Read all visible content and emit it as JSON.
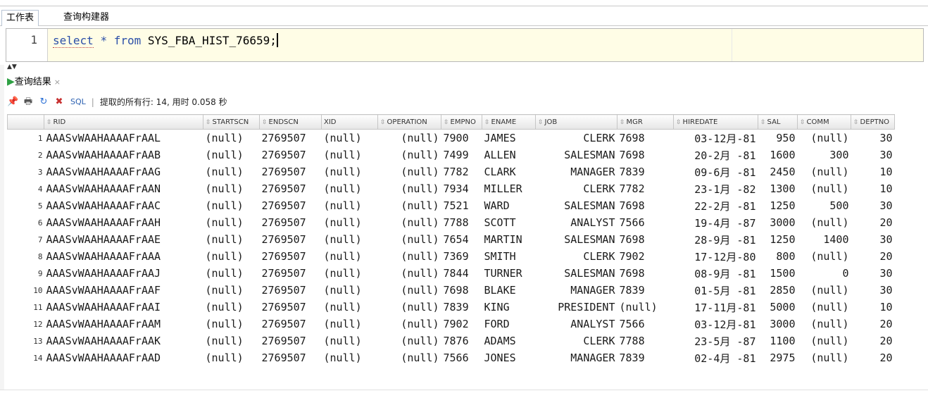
{
  "tabs": [
    "工作表",
    "查询构建器"
  ],
  "editor": {
    "line_number": "1",
    "kw_select": "select",
    "star": "*",
    "kw_from": "from",
    "table": "SYS_FBA_HIST_76659;"
  },
  "results": {
    "tab_label": "查询结果",
    "close": "×",
    "toolbar": {
      "sql_label": "SQL",
      "separator": "|",
      "status": "提取的所有行: 14, 用时 0.058 秒"
    },
    "columns": [
      "RID",
      "STARTSCN",
      "ENDSCN",
      "XID",
      "OPERATION",
      "EMPNO",
      "ENAME",
      "JOB",
      "MGR",
      "HIREDATE",
      "SAL",
      "COMM",
      "DEPTNO"
    ],
    "rows": [
      [
        "1",
        "AAASvWAAHAAAAFrAAL",
        "(null)",
        "2769507",
        "(null)",
        "(null)",
        "7900",
        "JAMES",
        "CLERK",
        "7698",
        "03-12月-81",
        "950",
        "(null)",
        "30"
      ],
      [
        "2",
        "AAASvWAAHAAAAFrAAB",
        "(null)",
        "2769507",
        "(null)",
        "(null)",
        "7499",
        "ALLEN",
        "SALESMAN",
        "7698",
        "20-2月 -81",
        "1600",
        "300",
        "30"
      ],
      [
        "3",
        "AAASvWAAHAAAAFrAAG",
        "(null)",
        "2769507",
        "(null)",
        "(null)",
        "7782",
        "CLARK",
        "MANAGER",
        "7839",
        "09-6月 -81",
        "2450",
        "(null)",
        "10"
      ],
      [
        "4",
        "AAASvWAAHAAAAFrAAN",
        "(null)",
        "2769507",
        "(null)",
        "(null)",
        "7934",
        "MILLER",
        "CLERK",
        "7782",
        "23-1月 -82",
        "1300",
        "(null)",
        "10"
      ],
      [
        "5",
        "AAASvWAAHAAAAFrAAC",
        "(null)",
        "2769507",
        "(null)",
        "(null)",
        "7521",
        "WARD",
        "SALESMAN",
        "7698",
        "22-2月 -81",
        "1250",
        "500",
        "30"
      ],
      [
        "6",
        "AAASvWAAHAAAAFrAAH",
        "(null)",
        "2769507",
        "(null)",
        "(null)",
        "7788",
        "SCOTT",
        "ANALYST",
        "7566",
        "19-4月 -87",
        "3000",
        "(null)",
        "20"
      ],
      [
        "7",
        "AAASvWAAHAAAAFrAAE",
        "(null)",
        "2769507",
        "(null)",
        "(null)",
        "7654",
        "MARTIN",
        "SALESMAN",
        "7698",
        "28-9月 -81",
        "1250",
        "1400",
        "30"
      ],
      [
        "8",
        "AAASvWAAHAAAAFrAAA",
        "(null)",
        "2769507",
        "(null)",
        "(null)",
        "7369",
        "SMITH",
        "CLERK",
        "7902",
        "17-12月-80",
        "800",
        "(null)",
        "20"
      ],
      [
        "9",
        "AAASvWAAHAAAAFrAAJ",
        "(null)",
        "2769507",
        "(null)",
        "(null)",
        "7844",
        "TURNER",
        "SALESMAN",
        "7698",
        "08-9月 -81",
        "1500",
        "0",
        "30"
      ],
      [
        "10",
        "AAASvWAAHAAAAFrAAF",
        "(null)",
        "2769507",
        "(null)",
        "(null)",
        "7698",
        "BLAKE",
        "MANAGER",
        "7839",
        "01-5月 -81",
        "2850",
        "(null)",
        "30"
      ],
      [
        "11",
        "AAASvWAAHAAAAFrAAI",
        "(null)",
        "2769507",
        "(null)",
        "(null)",
        "7839",
        "KING",
        "PRESIDENT",
        "(null)",
        "17-11月-81",
        "5000",
        "(null)",
        "10"
      ],
      [
        "12",
        "AAASvWAAHAAAAFrAAM",
        "(null)",
        "2769507",
        "(null)",
        "(null)",
        "7902",
        "FORD",
        "ANALYST",
        "7566",
        "03-12月-81",
        "3000",
        "(null)",
        "20"
      ],
      [
        "13",
        "AAASvWAAHAAAAFrAAK",
        "(null)",
        "2769507",
        "(null)",
        "(null)",
        "7876",
        "ADAMS",
        "CLERK",
        "7788",
        "23-5月 -87",
        "1100",
        "(null)",
        "20"
      ],
      [
        "14",
        "AAASvWAAHAAAAFrAAD",
        "(null)",
        "2769507",
        "(null)",
        "(null)",
        "7566",
        "JONES",
        "MANAGER",
        "7839",
        "02-4月 -81",
        "2975",
        "(null)",
        "20"
      ]
    ]
  }
}
